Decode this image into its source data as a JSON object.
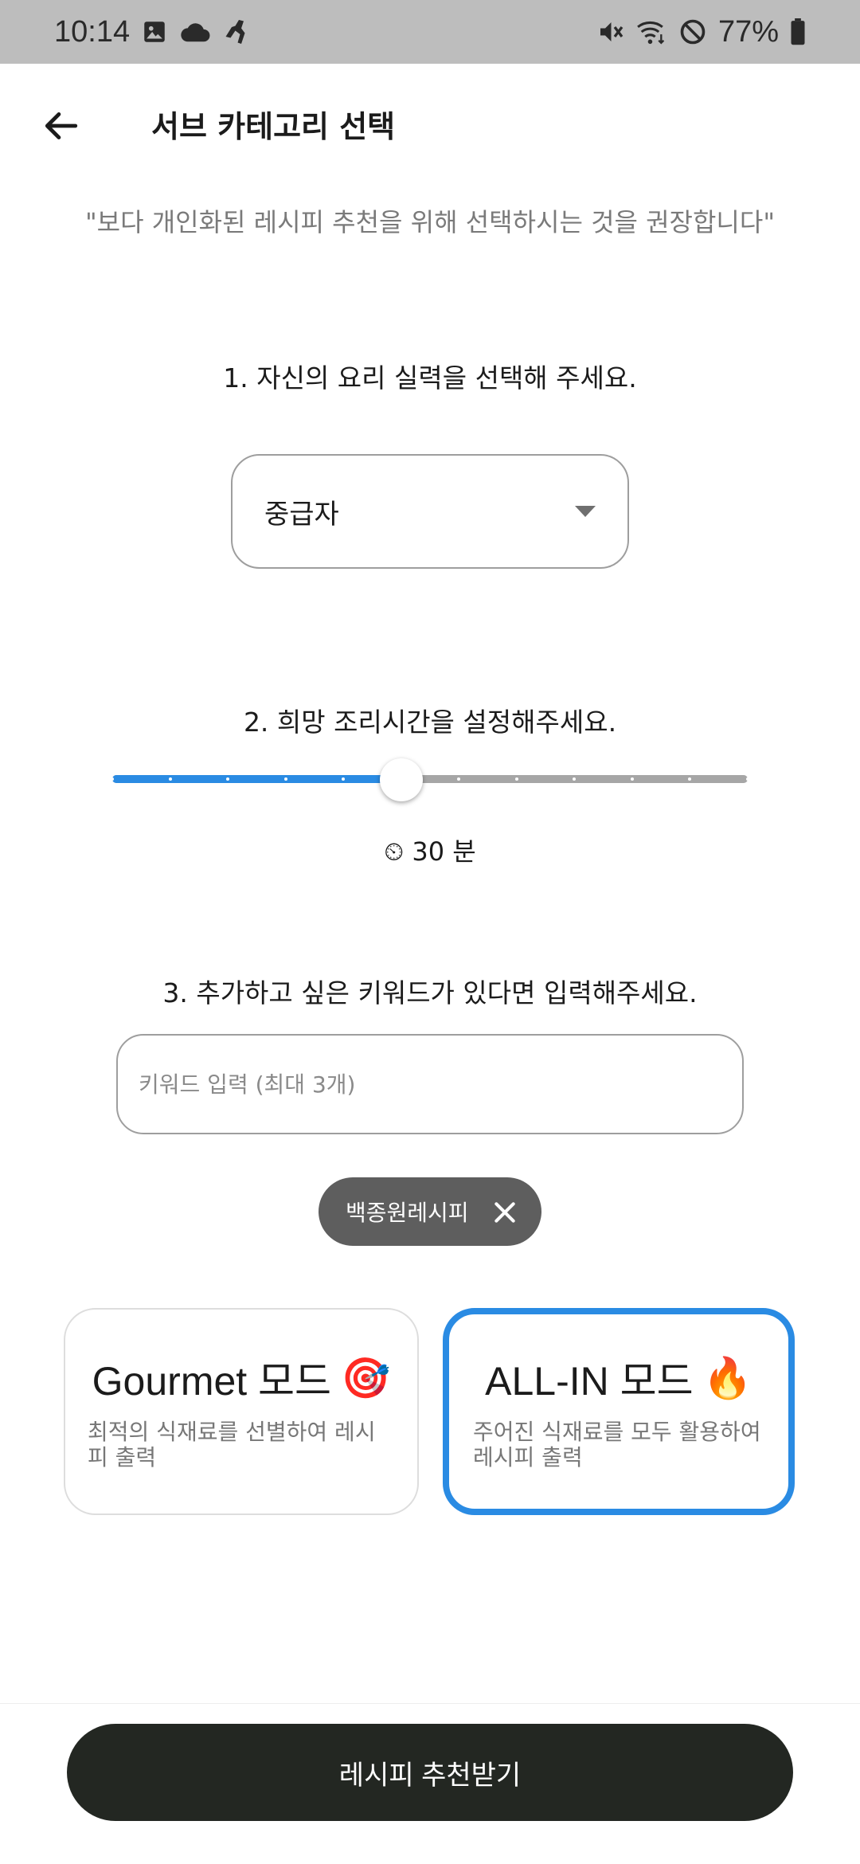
{
  "status_bar": {
    "time": "10:14",
    "battery": "77%",
    "icons_left": [
      "gallery-icon",
      "cloud-icon",
      "shoe-icon"
    ],
    "icons_right": [
      "vibrate-icon",
      "wifi-icon",
      "do-not-disturb-icon",
      "battery-icon"
    ]
  },
  "header": {
    "title": "서브 카테고리 선택"
  },
  "subtitle": "\"보다 개인화된 레시피 추천을 위해 선택하시는 것을 권장합니다\"",
  "section1": {
    "title": "1. 자신의 요리 실력을 선택해 주세요.",
    "selected": "중급자"
  },
  "section2": {
    "title": "2. 희망 조리시간을 설정해주세요.",
    "value_label": "⏲ 30 분",
    "steps": 12,
    "current_step": 5
  },
  "section3": {
    "title": "3. 추가하고 싶은 키워드가 있다면 입력해주세요.",
    "placeholder": "키워드 입력 (최대 3개)",
    "chips": [
      "백종원레시피"
    ]
  },
  "modes": {
    "gourmet": {
      "title": "Gourmet 모드",
      "emoji": "🎯",
      "desc_line1": "최적의 식재료를 선별하여 레시",
      "desc_line2": "피 출력"
    },
    "allin": {
      "title": "ALL-IN 모드",
      "emoji": "🔥",
      "desc_line1": "주어진 식재료를 모두 활용하여",
      "desc_line2": "레시피 출력"
    },
    "selected": "allin"
  },
  "cta": {
    "label": "레시피 추천받기"
  },
  "colors": {
    "accent": "#2a8be3",
    "cta_bg": "#232722",
    "chip_bg": "#5e5e5e",
    "status_bar_bg": "#bdbdbd"
  }
}
